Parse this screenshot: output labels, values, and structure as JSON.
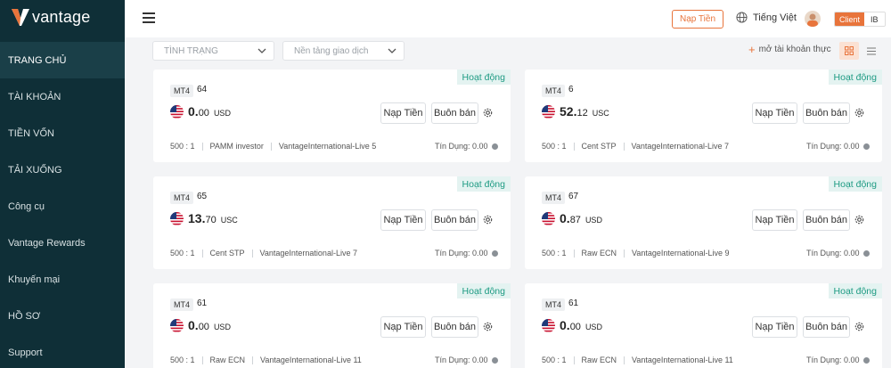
{
  "brand": {
    "name": "vantage"
  },
  "sidebar": {
    "items": [
      {
        "label": "TRANG CHỦ",
        "active": true
      },
      {
        "label": "TÀI KHOẢN"
      },
      {
        "label": "TIỀN VỐN"
      },
      {
        "label": "TẢI XUỐNG"
      },
      {
        "label": "Công cụ"
      },
      {
        "label": "Vantage Rewards"
      },
      {
        "label": "Khuyến mại"
      },
      {
        "label": "HỒ SƠ"
      },
      {
        "label": "Support"
      }
    ]
  },
  "header": {
    "deposit_label": "Nạp Tiền",
    "language": "Tiếng Việt",
    "toggle": {
      "client": "Client",
      "ib": "IB"
    }
  },
  "filters": {
    "status_placeholder": "TÌNH TRẠNG",
    "platform_placeholder": "Nền tảng giao dịch",
    "add_account_label": "mở tài khoản thực"
  },
  "colors": {
    "accent": "#e8743b",
    "sidebar_bg": "#0f2f37",
    "status_green": "#1e9b83"
  },
  "accounts": [
    {
      "status": "Hoạt động",
      "platform": "MT4",
      "number": "64",
      "balance_int": "0.",
      "balance_dec": "00",
      "currency": "USD",
      "deposit": "Nạp Tiền",
      "trade": "Buôn bán",
      "leverage": "500 : 1",
      "account_type": "PAMM investor",
      "server": "VantageInternational-Live 5",
      "credit": "Tín Dụng: 0.00"
    },
    {
      "status": "Hoạt động",
      "platform": "MT4",
      "number": "6",
      "balance_int": "52.",
      "balance_dec": "12",
      "currency": "USC",
      "deposit": "Nạp Tiền",
      "trade": "Buôn bán",
      "leverage": "500 : 1",
      "account_type": "Cent STP",
      "server": "VantageInternational-Live 7",
      "credit": "Tín Dụng: 0.00"
    },
    {
      "status": "Hoạt động",
      "platform": "MT4",
      "number": "65",
      "balance_int": "13.",
      "balance_dec": "70",
      "currency": "USC",
      "deposit": "Nạp Tiền",
      "trade": "Buôn bán",
      "leverage": "500 : 1",
      "account_type": "Cent STP",
      "server": "VantageInternational-Live 7",
      "credit": "Tín Dụng: 0.00"
    },
    {
      "status": "Hoạt động",
      "platform": "MT4",
      "number": "67",
      "balance_int": "0.",
      "balance_dec": "87",
      "currency": "USD",
      "deposit": "Nạp Tiền",
      "trade": "Buôn bán",
      "leverage": "500 : 1",
      "account_type": "Raw ECN",
      "server": "VantageInternational-Live 9",
      "credit": "Tín Dụng: 0.00"
    },
    {
      "status": "Hoạt động",
      "platform": "MT4",
      "number": "61",
      "balance_int": "0.",
      "balance_dec": "00",
      "currency": "USD",
      "deposit": "Nạp Tiền",
      "trade": "Buôn bán",
      "leverage": "500 : 1",
      "account_type": "Raw ECN",
      "server": "VantageInternational-Live 11",
      "credit": "Tín Dụng: 0.00"
    },
    {
      "status": "Hoạt động",
      "platform": "MT4",
      "number": "61",
      "balance_int": "0.",
      "balance_dec": "00",
      "currency": "USD",
      "deposit": "Nạp Tiền",
      "trade": "Buôn bán",
      "leverage": "500 : 1",
      "account_type": "Raw ECN",
      "server": "VantageInternational-Live 11",
      "credit": "Tín Dụng: 0.00"
    }
  ]
}
